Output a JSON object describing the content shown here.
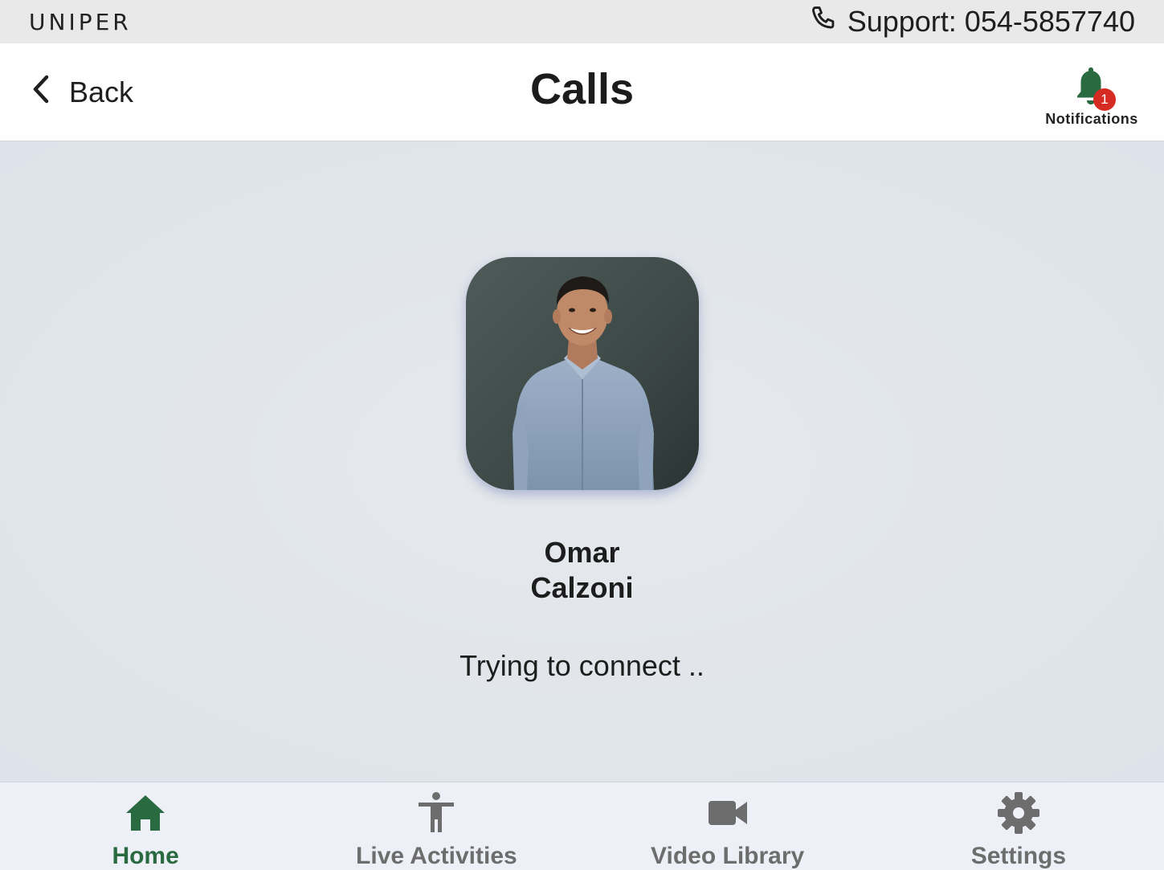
{
  "topbar": {
    "brand": "UNIPER",
    "support": "Support: 054-5857740",
    "phone_icon": "phone-icon"
  },
  "header": {
    "back_label": "Back",
    "title": "Calls",
    "notifications_label": "Notifications",
    "notifications_count": "1"
  },
  "call": {
    "first_name": "Omar",
    "last_name": "Calzoni",
    "status": "Trying to connect .."
  },
  "tabs": [
    {
      "label": "Home",
      "icon": "home-icon",
      "active": true
    },
    {
      "label": "Live Activities",
      "icon": "person-icon",
      "active": false
    },
    {
      "label": "Video Library",
      "icon": "video-camera-icon",
      "active": false
    },
    {
      "label": "Settings",
      "icon": "gear-icon",
      "active": false
    }
  ],
  "colors": {
    "accent": "#2a6a41",
    "badge": "#d62b23",
    "inactive_tab": "#6d6d6d"
  }
}
